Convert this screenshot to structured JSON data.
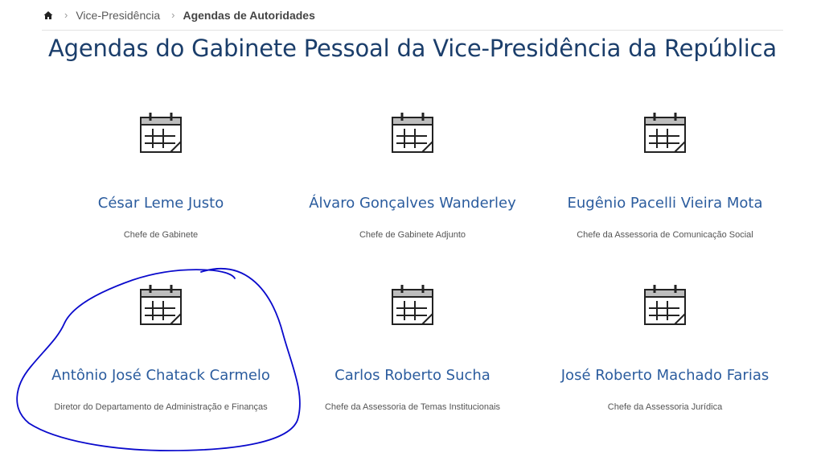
{
  "breadcrumb": {
    "home_icon": "home-icon",
    "items": [
      "Vice-Presidência",
      "Agendas de Autoridades"
    ]
  },
  "page": {
    "title": "Agendas do Gabinete Pessoal da Vice-Presidência da República"
  },
  "cards": [
    {
      "name": "César Leme Justo",
      "role": "Chefe de Gabinete",
      "icon": "calendar-icon"
    },
    {
      "name": "Álvaro Gonçalves Wanderley",
      "role": "Chefe de Gabinete Adjunto",
      "icon": "calendar-icon"
    },
    {
      "name": "Eugênio Pacelli Vieira Mota",
      "role": "Chefe da Assessoria de Comunicação Social",
      "icon": "calendar-icon"
    },
    {
      "name": "Antônio José Chatack Carmelo",
      "role": "Diretor do Departamento de Administração e Finanças",
      "icon": "calendar-icon"
    },
    {
      "name": "Carlos Roberto Sucha",
      "role": "Chefe da Assessoria de Temas Institucionais",
      "icon": "calendar-icon"
    },
    {
      "name": "José Roberto Machado Farias",
      "role": "Chefe da Assessoria Jurídica",
      "icon": "calendar-icon"
    }
  ],
  "colors": {
    "title": "#1b3e6b",
    "link": "#2b5c9e",
    "annotation": "#0a0acc"
  }
}
